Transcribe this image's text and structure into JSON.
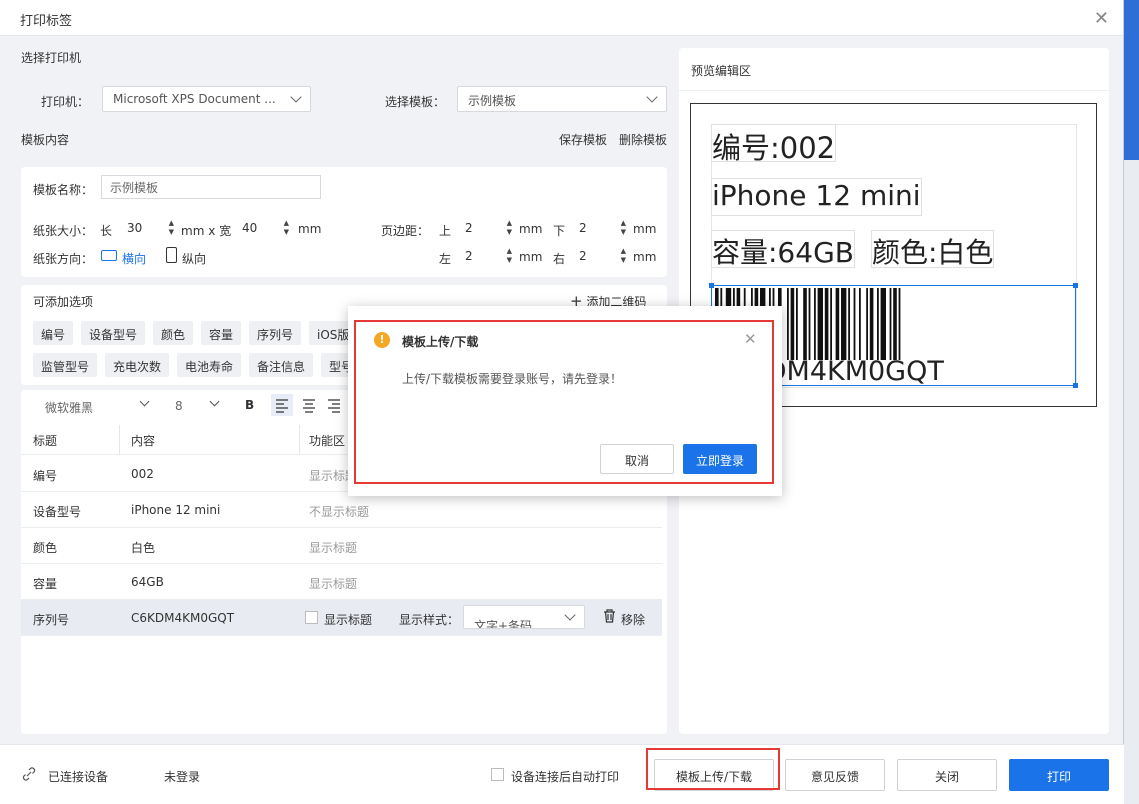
{
  "window": {
    "title": "打印标签"
  },
  "printer_section": {
    "heading": "选择打印机",
    "printer_label": "打印机：",
    "printer_value": "Microsoft XPS Document ...",
    "template_label": "选择模板：",
    "template_value": "示例模板"
  },
  "template_content": {
    "heading": "模板内容",
    "save_label": "保存模板",
    "delete_label": "删除模板",
    "name_label": "模板名称：",
    "name_value": "示例模板",
    "paper_size_label": "纸张大小：",
    "length_label": "长",
    "length_value": "30",
    "mmx_label": "mm x 宽",
    "width_value": "40",
    "mm": "mm",
    "margin_label": "页边距：",
    "top_label": "上",
    "top_value": "2",
    "bottom_label": "下",
    "bottom_value": "2",
    "left_label": "左",
    "left_value": "2",
    "right_label": "右",
    "right_value": "2",
    "orientation_label": "纸张方向：",
    "landscape_label": "横向",
    "portrait_label": "纵向"
  },
  "options": {
    "heading": "可添加选项",
    "add_qr_label": "添加二维码",
    "tags_row1": [
      "编号",
      "设备型号",
      "颜色",
      "容量",
      "序列号",
      "iOS版本"
    ],
    "tags_row2": [
      "监管型号",
      "充电次数",
      "电池寿命",
      "备注信息",
      "型号"
    ]
  },
  "toolbar": {
    "font": "微软雅黑",
    "size": "8",
    "bold": "B"
  },
  "table": {
    "headers": [
      "标题",
      "内容",
      "功能区"
    ],
    "rows": [
      {
        "title": "编号",
        "content": "002",
        "func": "显示标题"
      },
      {
        "title": "设备型号",
        "content": "iPhone 12 mini",
        "func": "不显示标题"
      },
      {
        "title": "颜色",
        "content": "白色",
        "func": "显示标题"
      },
      {
        "title": "容量",
        "content": "64GB",
        "func": "显示标题"
      },
      {
        "title": "序列号",
        "content": "C6KDM4KM0GQT",
        "func": "显示标题"
      }
    ],
    "style_label": "显示样式：",
    "style_value": "文字+条码",
    "remove_label": "移除"
  },
  "preview": {
    "heading": "预览编辑区",
    "line1": "编号:002",
    "line2": "iPhone 12 mini",
    "capacity": "容量:64GB",
    "color": "颜色:白色",
    "barcode_text": "C6KDM4KM0GQT"
  },
  "dialog": {
    "title": "模板上传/下载",
    "message": "上传/下载模板需要登录账号，请先登录！",
    "cancel_label": "取消",
    "login_label": "立即登录"
  },
  "footer": {
    "connected_label": "已连接设备",
    "login_status": "未登录",
    "auto_print_label": "设备连接后自动打印",
    "upload_label": "模板上传/下载",
    "feedback_label": "意见反馈",
    "close_label": "关闭",
    "print_label": "打印"
  },
  "colors": {
    "accent": "#1a73e8",
    "highlight": "#e53935",
    "warning": "#f5a623"
  }
}
